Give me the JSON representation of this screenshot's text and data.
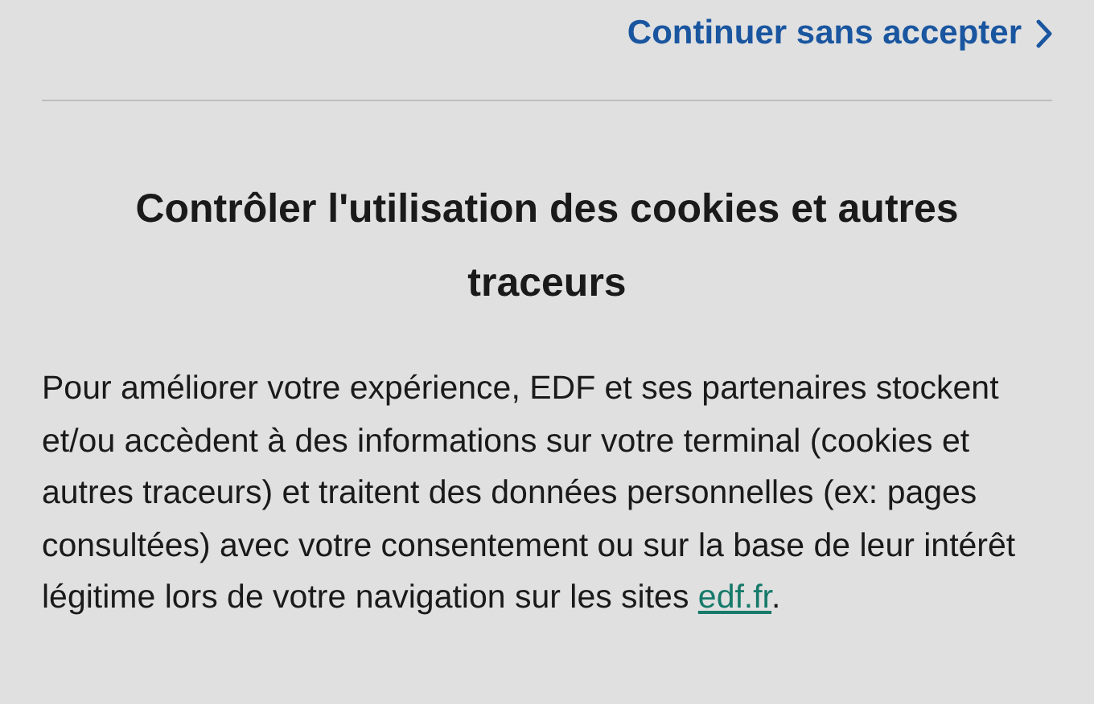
{
  "header": {
    "continue_link": "Continuer sans accepter"
  },
  "dialog": {
    "title": "Contrôler l'utilisation des cookies et autres traceurs",
    "paragraph": {
      "text": "Pour améliorer votre expérience, EDF et ses partenaires stockent et/ou accèdent à des informations sur votre terminal (cookies et autres traceurs) et traitent des données personnelles (ex: pages consultées) avec votre consentement ou sur la base de leur intérêt légitime lors de votre navigation sur les sites ",
      "link": "edf.fr",
      "end": "."
    }
  }
}
